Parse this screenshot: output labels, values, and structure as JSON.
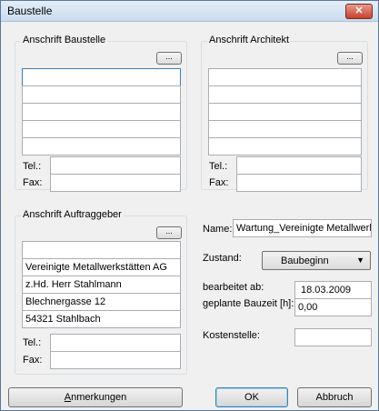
{
  "window": {
    "title": "Baustelle",
    "close_symbol": "✕"
  },
  "baustelle": {
    "title": "Anschrift Baustelle",
    "dots_label": "...",
    "lines": [
      "",
      "",
      "",
      "",
      ""
    ],
    "tel_label": "Tel.:",
    "tel_value": "",
    "fax_label": "Fax:",
    "fax_value": ""
  },
  "architekt": {
    "title": "Anschrift Architekt",
    "dots_label": "...",
    "lines": [
      "",
      "",
      "",
      "",
      ""
    ],
    "tel_label": "Tel.:",
    "tel_value": "",
    "fax_label": "Fax:",
    "fax_value": ""
  },
  "auftraggeber": {
    "title": "Anschrift Auftraggeber",
    "dots_label": "...",
    "lines": [
      "",
      "Vereinigte Metallwerkstätten AG",
      "z.Hd. Herr Stahlmann",
      "Blechnergasse 12",
      "54321 Stahlbach"
    ],
    "tel_label": "Tel.:",
    "tel_value": "",
    "fax_label": "Fax:",
    "fax_value": ""
  },
  "details": {
    "name_label": "Name:",
    "name_value": "Wartung_Vereinigte Metallwerl",
    "zustand_label": "Zustand:",
    "zustand_value": "Baubeginn",
    "bearbeitet_label": "bearbeitet ab:",
    "bearbeitet_value": "18.03.2009",
    "bauzeit_label": "geplante Bauzeit [h]:",
    "bauzeit_value": "0,00",
    "kostenstelle_label": "Kostenstelle:",
    "kostenstelle_value": ""
  },
  "buttons": {
    "anmerkungen_first": "A",
    "anmerkungen_rest": "nmerkungen",
    "ok": "OK",
    "abbruch": "Abbruch"
  }
}
